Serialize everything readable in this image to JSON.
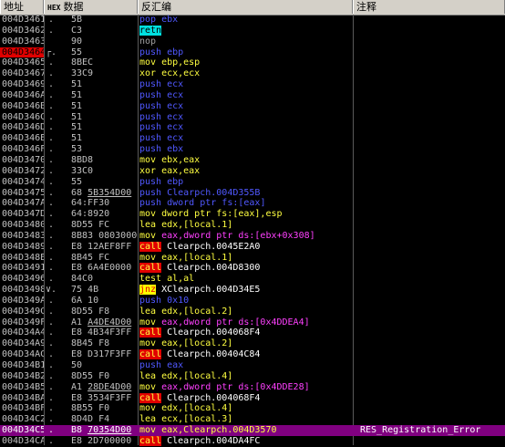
{
  "header": {
    "address": "地址",
    "hex_label": "HEX",
    "data": "数据",
    "disasm": "反汇编",
    "comment": "注释"
  },
  "rows": [
    {
      "addr": "004D3461",
      "mark": ".",
      "hex": "5B",
      "mn": "pop",
      "op": "ebx",
      "kind": "pop"
    },
    {
      "addr": "004D3462",
      "mark": ".",
      "hex": "C3",
      "mn": "retn",
      "op": "",
      "kind": "retn"
    },
    {
      "addr": "004D3463",
      "mark": "",
      "hex": "90",
      "mn": "nop",
      "op": "",
      "kind": "nop"
    },
    {
      "addr": "004D3464",
      "mark": "┌.",
      "hex": "55",
      "mn": "push",
      "op": "ebp",
      "kind": "push"
    },
    {
      "addr": "004D3465",
      "mark": ".",
      "hex": "8BEC",
      "mn": "mov",
      "op": "ebp,esp",
      "kind": "mov"
    },
    {
      "addr": "004D3467",
      "mark": ".",
      "hex": "33C9",
      "mn": "xor",
      "op": "ecx,ecx",
      "kind": "xor"
    },
    {
      "addr": "004D3469",
      "mark": ".",
      "hex": "51",
      "mn": "push",
      "op": "ecx",
      "kind": "push"
    },
    {
      "addr": "004D346A",
      "mark": ".",
      "hex": "51",
      "mn": "push",
      "op": "ecx",
      "kind": "push"
    },
    {
      "addr": "004D346B",
      "mark": ".",
      "hex": "51",
      "mn": "push",
      "op": "ecx",
      "kind": "push"
    },
    {
      "addr": "004D346C",
      "mark": ".",
      "hex": "51",
      "mn": "push",
      "op": "ecx",
      "kind": "push"
    },
    {
      "addr": "004D346D",
      "mark": ".",
      "hex": "51",
      "mn": "push",
      "op": "ecx",
      "kind": "push"
    },
    {
      "addr": "004D346E",
      "mark": ".",
      "hex": "51",
      "mn": "push",
      "op": "ecx",
      "kind": "push"
    },
    {
      "addr": "004D346F",
      "mark": ".",
      "hex": "53",
      "mn": "push",
      "op": "ebx",
      "kind": "push"
    },
    {
      "addr": "004D3470",
      "mark": ".",
      "hex": "8BD8",
      "mn": "mov",
      "op": "ebx,eax",
      "kind": "mov"
    },
    {
      "addr": "004D3472",
      "mark": ".",
      "hex": "33C0",
      "mn": "xor",
      "op": "eax,eax",
      "kind": "xor"
    },
    {
      "addr": "004D3474",
      "mark": ".",
      "hex": "55",
      "mn": "push",
      "op": "ebp",
      "kind": "push"
    },
    {
      "addr": "004D3475",
      "mark": ".",
      "hex": "68",
      "hexu": "5B354D00",
      "mn": "push",
      "op": "Clearpch.004D355B",
      "kind": "push"
    },
    {
      "addr": "004D347A",
      "mark": ".",
      "hex": "64:FF30",
      "mn": "push",
      "op": "dword ptr fs:[eax]",
      "kind": "push"
    },
    {
      "addr": "004D347D",
      "mark": ".",
      "hex": "64:8920",
      "mn": "mov",
      "op": "dword ptr fs:[eax],esp",
      "kind": "mov"
    },
    {
      "addr": "004D3480",
      "mark": ".",
      "hex": "8D55 FC",
      "mn": "lea",
      "op": "edx,[local.1]",
      "kind": "lea"
    },
    {
      "addr": "004D3483",
      "mark": ".",
      "hex": "8B83 08030000",
      "mn": "mov",
      "op": "eax,dword ptr ds:[ebx+0x308]",
      "kind": "mov-mem"
    },
    {
      "addr": "004D3489",
      "mark": ".",
      "hex": "E8 12AEF8FF",
      "mn": "call",
      "op": "Clearpch.0045E2A0",
      "kind": "call"
    },
    {
      "addr": "004D348E",
      "mark": ".",
      "hex": "8B45 FC",
      "mn": "mov",
      "op": "eax,[local.1]",
      "kind": "mov"
    },
    {
      "addr": "004D3491",
      "mark": ".",
      "hex": "E8 6A4E0000",
      "mn": "call",
      "op": "Clearpch.004D8300",
      "kind": "call"
    },
    {
      "addr": "004D3496",
      "mark": ".",
      "hex": "84C0",
      "mn": "test",
      "op": "al,al",
      "kind": "test"
    },
    {
      "addr": "004D3498",
      "mark": "∨.",
      "hex": "75 4B",
      "mn": "jnz",
      "op": "XClearpch.004D34E5",
      "kind": "jnz"
    },
    {
      "addr": "004D349A",
      "mark": ".",
      "hex": "6A 10",
      "mn": "push",
      "op": "0x10",
      "kind": "push"
    },
    {
      "addr": "004D349C",
      "mark": ".",
      "hex": "8D55 F8",
      "mn": "lea",
      "op": "edx,[local.2]",
      "kind": "lea"
    },
    {
      "addr": "004D349F",
      "mark": ".",
      "hex": "A1",
      "hexu": "A4DE4D00",
      "mn": "mov",
      "op": "eax,dword ptr ds:[0x4DDEA4]",
      "kind": "mov-mem"
    },
    {
      "addr": "004D34A4",
      "mark": ".",
      "hex": "E8 4B34F3FF",
      "mn": "call",
      "op": "Clearpch.004068F4",
      "kind": "call"
    },
    {
      "addr": "004D34A9",
      "mark": ".",
      "hex": "8B45 F8",
      "mn": "mov",
      "op": "eax,[local.2]",
      "kind": "mov"
    },
    {
      "addr": "004D34AC",
      "mark": ".",
      "hex": "E8 D317F3FF",
      "mn": "call",
      "op": "Clearpch.00404C84",
      "kind": "call"
    },
    {
      "addr": "004D34B1",
      "mark": ".",
      "hex": "50",
      "mn": "push",
      "op": "eax",
      "kind": "push"
    },
    {
      "addr": "004D34B2",
      "mark": ".",
      "hex": "8D55 F0",
      "mn": "lea",
      "op": "edx,[local.4]",
      "kind": "lea"
    },
    {
      "addr": "004D34B5",
      "mark": ".",
      "hex": "A1",
      "hexu": "28DE4D00",
      "mn": "mov",
      "op": "eax,dword ptr ds:[0x4DDE28]",
      "kind": "mov-mem"
    },
    {
      "addr": "004D34BA",
      "mark": ".",
      "hex": "E8 3534F3FF",
      "mn": "call",
      "op": "Clearpch.004068F4",
      "kind": "call"
    },
    {
      "addr": "004D34BF",
      "mark": ".",
      "hex": "8B55 F0",
      "mn": "mov",
      "op": "edx,[local.4]",
      "kind": "mov"
    },
    {
      "addr": "004D34C2",
      "mark": ".",
      "hex": "8D4D F4",
      "mn": "lea",
      "op": "ecx,[local.3]",
      "kind": "lea"
    },
    {
      "addr": "004D34C5",
      "mark": ".",
      "hex": "B8",
      "hexu": "70354D00",
      "mn": "mov",
      "op": "eax,Clearpch.004D3570",
      "kind": "mov",
      "comment": "RES_Registration_Error",
      "selected": true
    },
    {
      "addr": "004D34CA",
      "mark": ".",
      "hex": "E8 2D700000",
      "mn": "call",
      "op": "Clearpch.004DA4FC",
      "kind": "call"
    }
  ],
  "current_row_addr": "004D3464",
  "colors": {
    "background": "#000000",
    "address_text": "#c0c0c0",
    "current_address_bg": "#e00000",
    "selected_row_bg": "#800080",
    "push_pop": "#5058ff",
    "mov_xor_lea": "#ffff40",
    "call_bg": "#e00000",
    "jnz_bg": "#ffff00",
    "retn_bg": "#00e0e0",
    "memory_operand": "#ff40ff"
  }
}
